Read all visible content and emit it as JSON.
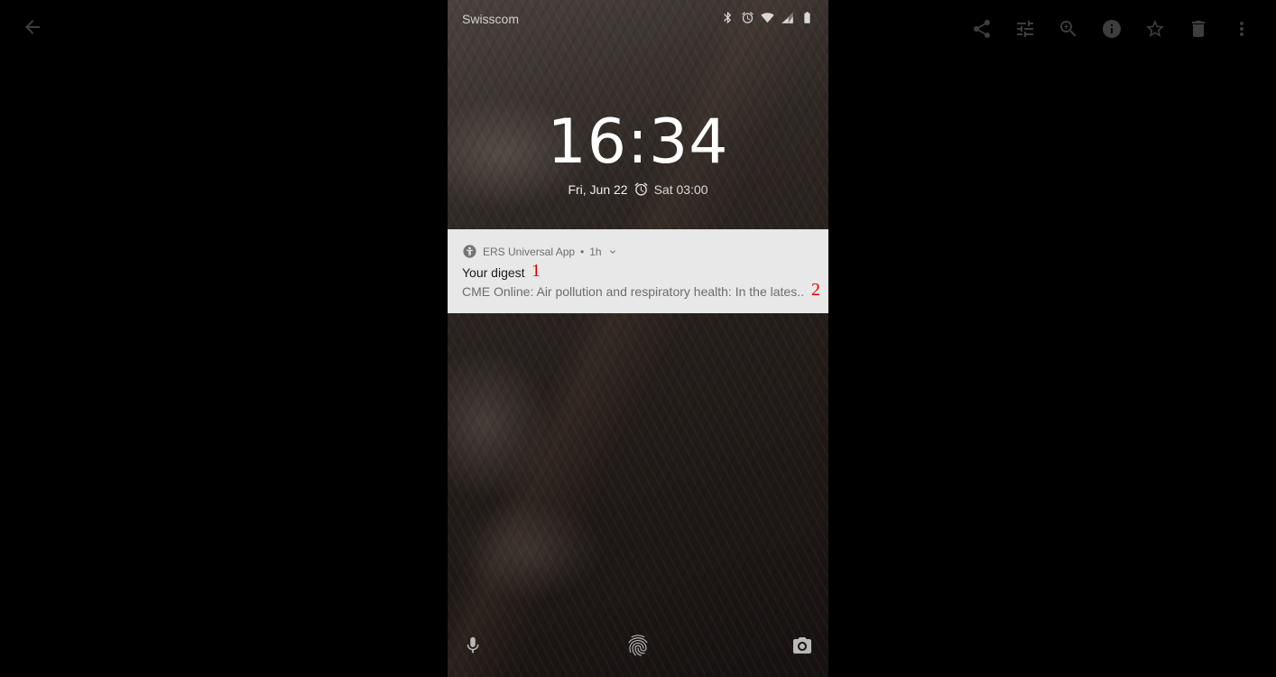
{
  "viewer": {
    "toolbar": [
      {
        "name": "share-icon",
        "label": "Share"
      },
      {
        "name": "edit-adjust-icon",
        "label": "Edit"
      },
      {
        "name": "zoom-in-icon",
        "label": "Zoom"
      },
      {
        "name": "info-icon",
        "label": "Info"
      },
      {
        "name": "star-icon",
        "label": "Favorite"
      },
      {
        "name": "delete-icon",
        "label": "Delete"
      },
      {
        "name": "more-vert-icon",
        "label": "More options"
      }
    ]
  },
  "phone": {
    "status_bar": {
      "carrier": "Swisscom",
      "icons": [
        "bluetooth-icon",
        "alarm-icon",
        "wifi-icon",
        "cell-signal-icon",
        "battery-icon"
      ]
    },
    "lockscreen": {
      "time": "16:34",
      "date": "Fri, Jun 22",
      "next_alarm": "Sat 03:00"
    },
    "notification": {
      "app_name": "ERS Universal App",
      "separator": "•",
      "age": "1h",
      "title": "Your digest",
      "body": "CME Online: Air pollution and respiratory health: In the lates..",
      "markers": [
        "1",
        "2"
      ]
    },
    "bottom_shortcuts": [
      "microphone-icon",
      "fingerprint-icon",
      "camera-icon"
    ]
  }
}
